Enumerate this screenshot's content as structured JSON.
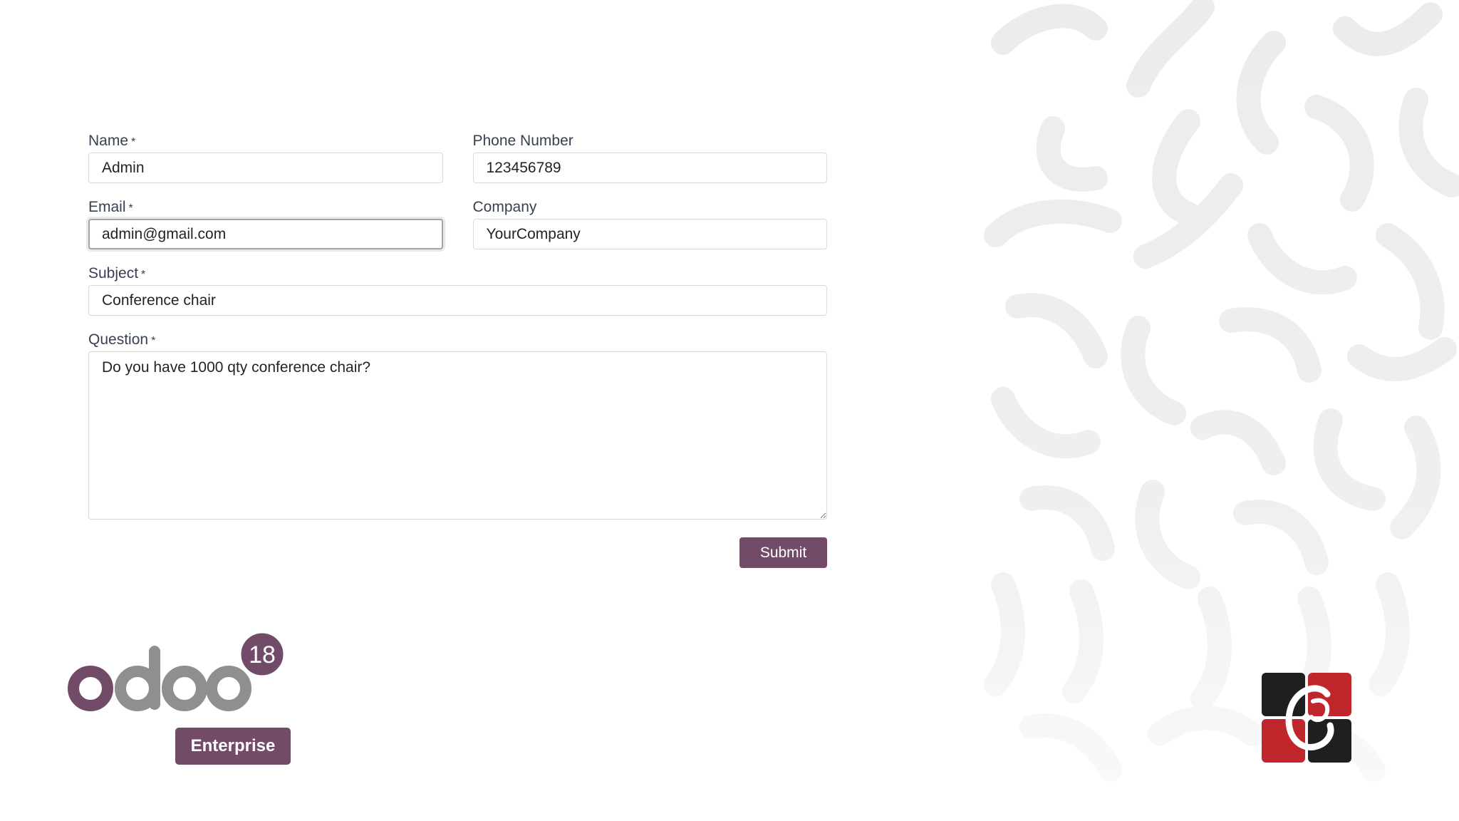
{
  "form": {
    "name": {
      "label": "Name",
      "required_mark": "*",
      "value": "Admin"
    },
    "phone": {
      "label": "Phone Number",
      "value": "123456789"
    },
    "email": {
      "label": "Email",
      "required_mark": "*",
      "value": "admin@gmail.com"
    },
    "company": {
      "label": "Company",
      "value": "YourCompany"
    },
    "subject": {
      "label": "Subject",
      "required_mark": "*",
      "value": "Conference chair"
    },
    "question": {
      "label": "Question",
      "required_mark": "*",
      "value": "Do you have 1000 qty conference chair?"
    },
    "submit_label": "Submit"
  },
  "branding": {
    "odoo_wordmark": "odoo",
    "version_badge": "18",
    "edition_badge": "Enterprise",
    "brand_color": "#714b67",
    "company_logo_colors": [
      "#1f1f1f",
      "#c0272d"
    ]
  },
  "decor": {
    "pattern_icon": "squiggle-pattern"
  }
}
